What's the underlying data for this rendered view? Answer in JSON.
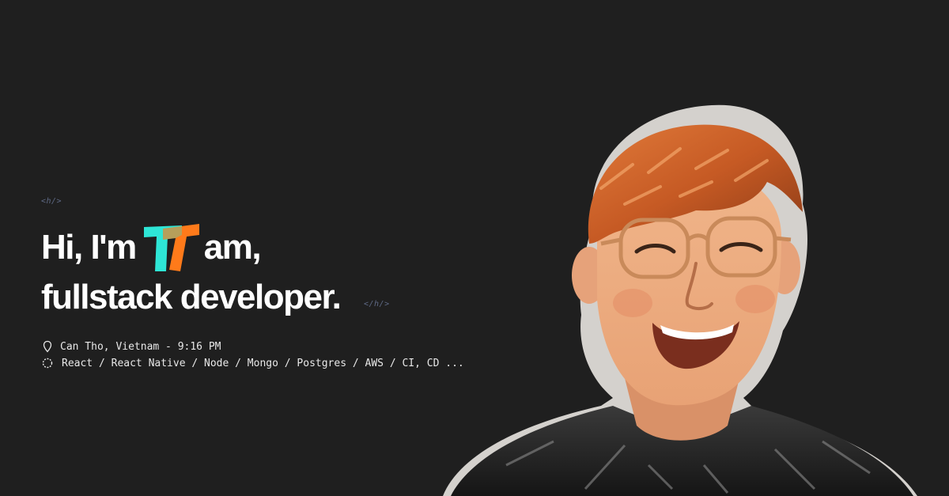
{
  "hero": {
    "tag_open": "<h/>",
    "tag_close": "</h/>",
    "greeting_prefix": "Hi, I'm",
    "name_suffix": "am,",
    "role": "fullstack developer.",
    "location": "Can Tho, Vietnam - 9:16 PM",
    "stack": "React / React Native / Node / Mongo / Postgres / AWS / CI, CD ..."
  },
  "logo": {
    "primary_color": "#2ee6d6",
    "secondary_color": "#ff7a1a"
  },
  "icons": {
    "location": "map-pin-icon",
    "stack": "loader-icon"
  }
}
